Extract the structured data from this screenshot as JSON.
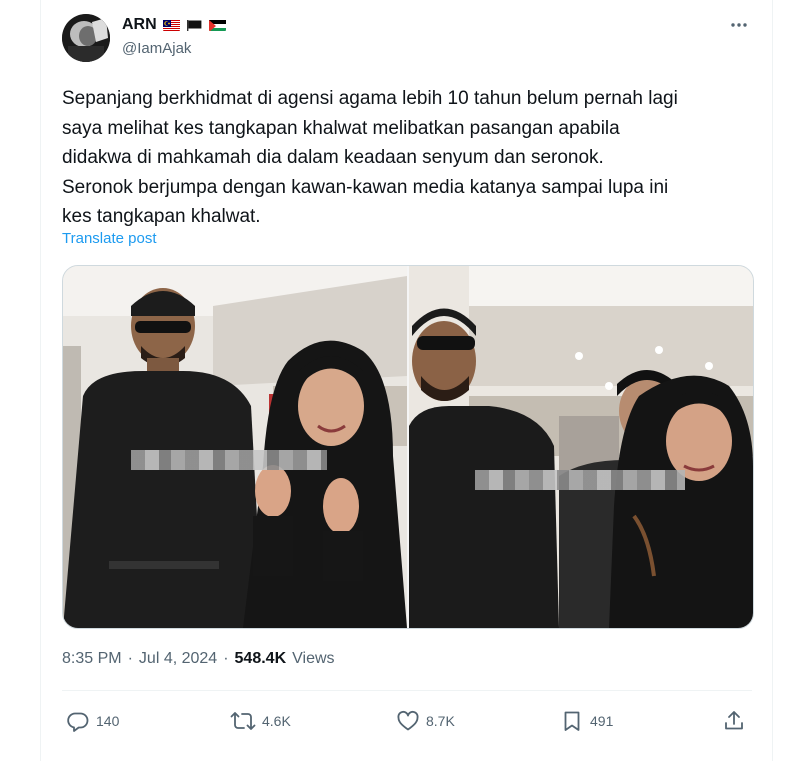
{
  "author": {
    "display_name": "ARN",
    "handle": "@IamAjak",
    "flags": [
      "malaysia-flag",
      "black-flag",
      "palestine-flag"
    ]
  },
  "more_icon": "more-horizontal-icon",
  "tweet": {
    "text": "Sepanjang berkhidmat di agensi agama lebih 10 tahun belum pernah lagi\nsaya melihat kes tangkapan khalwat melibatkan pasangan apabila\ndidakwa di mahkamah dia dalam keadaan senyum dan seronok.\nSeronok berjumpa dengan kawan-kawan media katanya sampai lupa ini\nkes tangkapan khalwat.",
    "translate_label": "Translate post"
  },
  "meta": {
    "time": "8:35 PM",
    "separator": "·",
    "date": "Jul 4, 2024",
    "views_count": "548.4K",
    "views_label": "Views"
  },
  "actions": {
    "replies": "140",
    "reposts": "4.6K",
    "likes": "8.7K",
    "bookmarks": "491"
  },
  "colors": {
    "text_primary": "#0f1419",
    "text_secondary": "#536471",
    "link": "#1d9bf0",
    "border": "#cfd9de"
  }
}
